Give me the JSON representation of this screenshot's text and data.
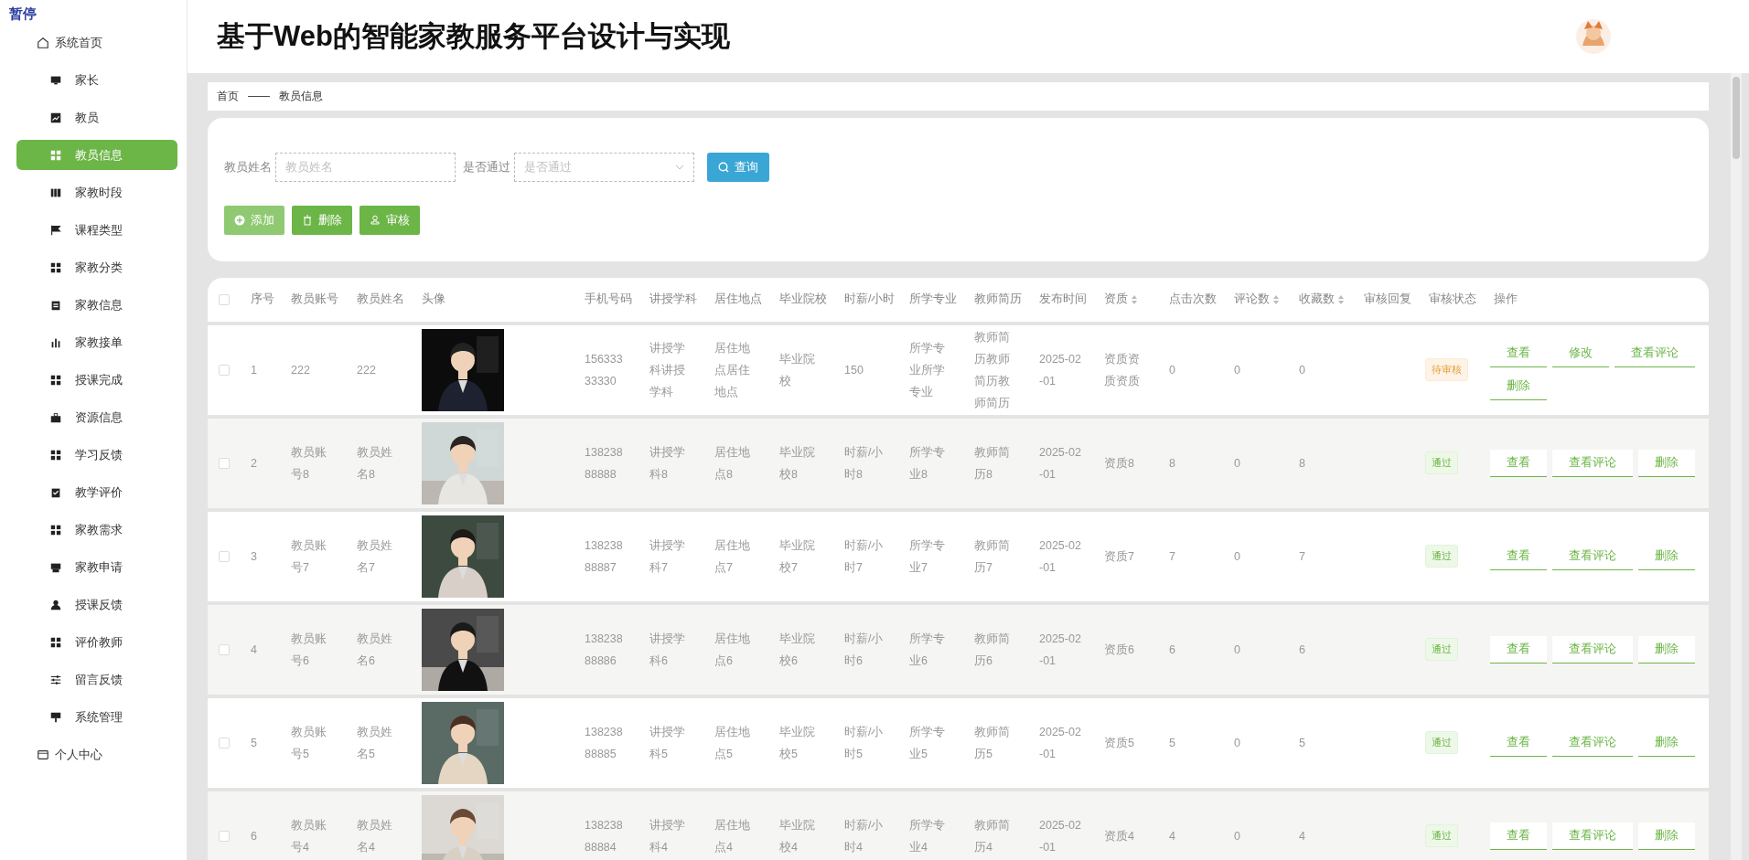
{
  "pause_label": "暂停",
  "sidebar": {
    "items": [
      {
        "label": "系统首页",
        "kind": "top",
        "selected": false
      },
      {
        "label": "家长",
        "kind": "sub",
        "selected": false
      },
      {
        "label": "教员",
        "kind": "sub",
        "selected": false
      },
      {
        "label": "教员信息",
        "kind": "sub",
        "selected": true
      },
      {
        "label": "家教时段",
        "kind": "sub",
        "selected": false
      },
      {
        "label": "课程类型",
        "kind": "sub",
        "selected": false
      },
      {
        "label": "家教分类",
        "kind": "sub",
        "selected": false
      },
      {
        "label": "家教信息",
        "kind": "sub",
        "selected": false
      },
      {
        "label": "家教接单",
        "kind": "sub",
        "selected": false
      },
      {
        "label": "授课完成",
        "kind": "sub",
        "selected": false
      },
      {
        "label": "资源信息",
        "kind": "sub",
        "selected": false
      },
      {
        "label": "学习反馈",
        "kind": "sub",
        "selected": false
      },
      {
        "label": "教学评价",
        "kind": "sub",
        "selected": false
      },
      {
        "label": "家教需求",
        "kind": "sub",
        "selected": false
      },
      {
        "label": "家教申请",
        "kind": "sub",
        "selected": false
      },
      {
        "label": "授课反馈",
        "kind": "sub",
        "selected": false
      },
      {
        "label": "评价教师",
        "kind": "sub",
        "selected": false
      },
      {
        "label": "留言反馈",
        "kind": "sub",
        "selected": false
      },
      {
        "label": "系统管理",
        "kind": "sub",
        "selected": false
      },
      {
        "label": "个人中心",
        "kind": "top",
        "selected": false
      }
    ]
  },
  "header": {
    "title": "基于Web的智能家教服务平台设计与实现"
  },
  "breadcrumb": [
    "首页",
    "——",
    "教员信息"
  ],
  "search": {
    "fields": [
      {
        "label": "教员姓名",
        "placeholder": "教员姓名",
        "kind": "text"
      },
      {
        "label": "是否通过",
        "placeholder": "是否通过",
        "kind": "select"
      }
    ],
    "button": "查询"
  },
  "actions": [
    {
      "label": "添加",
      "kind": "add",
      "hovered": true
    },
    {
      "label": "删除",
      "kind": "delete",
      "hovered": false
    },
    {
      "label": "审核",
      "kind": "audit",
      "hovered": false
    }
  ],
  "table": {
    "header_checked": false,
    "columns": [
      {
        "label": "序号",
        "sortable": false
      },
      {
        "label": "教员账号",
        "sortable": false
      },
      {
        "label": "教员姓名",
        "sortable": false
      },
      {
        "label": "头像",
        "sortable": false
      },
      {
        "label": "手机号码",
        "sortable": false
      },
      {
        "label": "讲授学科",
        "sortable": false
      },
      {
        "label": "居住地点",
        "sortable": false
      },
      {
        "label": "毕业院校",
        "sortable": false
      },
      {
        "label": "时薪/小时",
        "sortable": false
      },
      {
        "label": "所学专业",
        "sortable": false
      },
      {
        "label": "教师简历",
        "sortable": false
      },
      {
        "label": "发布时间",
        "sortable": false
      },
      {
        "label": "资质",
        "sortable": true
      },
      {
        "label": "点击次数",
        "sortable": false
      },
      {
        "label": "评论数",
        "sortable": true
      },
      {
        "label": "收藏数",
        "sortable": true
      },
      {
        "label": "审核回复",
        "sortable": false
      },
      {
        "label": "审核状态",
        "sortable": false
      },
      {
        "label": "操作",
        "sortable": false
      }
    ],
    "rows": [
      {
        "checked": false,
        "cells": [
          "1",
          "222",
          "222",
          {
            "kind": "picture"
          },
          "15633333330",
          "讲授学科讲授学科",
          "居住地点居住地点",
          "毕业院校",
          "150",
          "所学专业所学专业",
          "教师简历教师简历教师简历",
          "2025-02-01",
          "资质资质资质",
          "0",
          "0",
          "0"
        ],
        "status": {
          "label": "待审核",
          "kind": "pending"
        },
        "operations": [
          "查看",
          "修改",
          "查看评论",
          "删除"
        ]
      },
      {
        "checked": false,
        "cells": [
          "2",
          "教员账号8",
          "教员姓名8",
          {
            "kind": "picture"
          },
          "13823888888",
          "讲授学科8",
          "居住地点8",
          "毕业院校8",
          "时薪/小时8",
          "所学专业8",
          "教师简历8",
          "2025-02-01",
          "资质8",
          "8",
          "0",
          "8"
        ],
        "status": {
          "label": "通过",
          "kind": "passed"
        },
        "operations": [
          "查看",
          "查看评论",
          "删除"
        ]
      },
      {
        "checked": false,
        "cells": [
          "3",
          "教员账号7",
          "教员姓名7",
          {
            "kind": "picture"
          },
          "13823888887",
          "讲授学科7",
          "居住地点7",
          "毕业院校7",
          "时薪/小时7",
          "所学专业7",
          "教师简历7",
          "2025-02-01",
          "资质7",
          "7",
          "0",
          "7"
        ],
        "status": {
          "label": "通过",
          "kind": "passed"
        },
        "operations": [
          "查看",
          "查看评论",
          "删除"
        ]
      },
      {
        "checked": false,
        "cells": [
          "4",
          "教员账号6",
          "教员姓名6",
          {
            "kind": "picture"
          },
          "13823888886",
          "讲授学科6",
          "居住地点6",
          "毕业院校6",
          "时薪/小时6",
          "所学专业6",
          "教师简历6",
          "2025-02-01",
          "资质6",
          "6",
          "0",
          "6"
        ],
        "status": {
          "label": "通过",
          "kind": "passed"
        },
        "operations": [
          "查看",
          "查看评论",
          "删除"
        ]
      },
      {
        "checked": false,
        "cells": [
          "5",
          "教员账号5",
          "教员姓名5",
          {
            "kind": "picture"
          },
          "13823888885",
          "讲授学科5",
          "居住地点5",
          "毕业院校5",
          "时薪/小时5",
          "所学专业5",
          "教师简历5",
          "2025-02-01",
          "资质5",
          "5",
          "0",
          "5"
        ],
        "status": {
          "label": "通过",
          "kind": "passed"
        },
        "operations": [
          "查看",
          "查看评论",
          "删除"
        ]
      },
      {
        "checked": false,
        "cells": [
          "6",
          "教员账号4",
          "教员姓名4",
          {
            "kind": "picture"
          },
          "13823888884",
          "讲授学科4",
          "居住地点4",
          "毕业院校4",
          "时薪/小时4",
          "所学专业4",
          "教师简历4",
          "2025-02-01",
          "资质4",
          "4",
          "0",
          "4"
        ],
        "status": {
          "label": "通过",
          "kind": "passed"
        },
        "operations": [
          "查看",
          "查看评论",
          "删除"
        ]
      }
    ]
  }
}
